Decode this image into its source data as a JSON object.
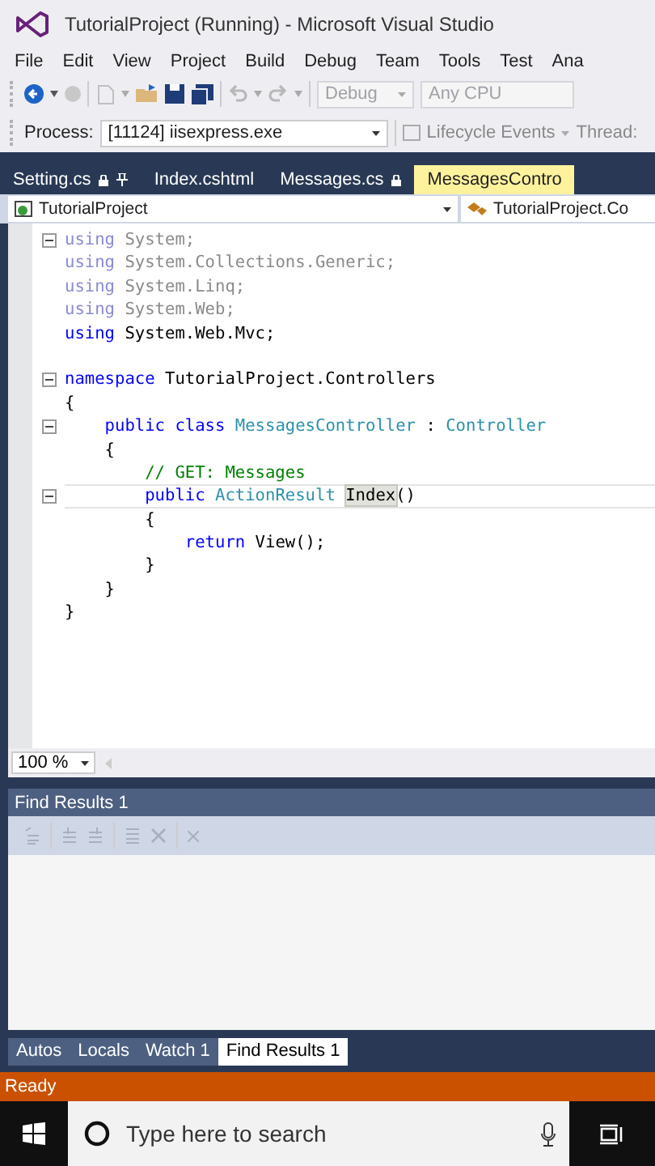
{
  "window": {
    "title": "TutorialProject (Running) - Microsoft Visual Studio"
  },
  "menu": [
    "File",
    "Edit",
    "View",
    "Project",
    "Build",
    "Debug",
    "Team",
    "Tools",
    "Test",
    "Ana"
  ],
  "toolbar": {
    "configuration": "Debug",
    "platform": "Any CPU"
  },
  "debug_location": {
    "process_label": "Process:",
    "process": "[11124] iisexpress.exe",
    "lifecycle": "Lifecycle Events",
    "thread_label": "Thread:"
  },
  "tabs": [
    {
      "label": "Setting.cs",
      "selected": false,
      "locked": true,
      "pinned": true
    },
    {
      "label": "Index.cshtml",
      "selected": false,
      "locked": false,
      "pinned": false
    },
    {
      "label": "Messages.cs",
      "selected": false,
      "locked": true,
      "pinned": false
    },
    {
      "label": "MessagesContro",
      "selected": true,
      "locked": false,
      "pinned": false
    }
  ],
  "navigation": {
    "project": "TutorialProject",
    "type": "TutorialProject.Co"
  },
  "code": {
    "lines": [
      {
        "fold": true,
        "current": false,
        "tokens": [
          {
            "text": "using",
            "kind": "keyword-faded"
          },
          {
            "text": " System;",
            "kind": "plain-faded"
          }
        ]
      },
      {
        "fold": false,
        "current": false,
        "tokens": [
          {
            "text": "using",
            "kind": "keyword-faded"
          },
          {
            "text": " System.Collections.Generic;",
            "kind": "plain-faded"
          }
        ]
      },
      {
        "fold": false,
        "current": false,
        "tokens": [
          {
            "text": "using",
            "kind": "keyword-faded"
          },
          {
            "text": " System.Linq;",
            "kind": "plain-faded"
          }
        ]
      },
      {
        "fold": false,
        "current": false,
        "tokens": [
          {
            "text": "using",
            "kind": "keyword-faded"
          },
          {
            "text": " System.Web;",
            "kind": "plain-faded"
          }
        ]
      },
      {
        "fold": false,
        "current": false,
        "tokens": [
          {
            "text": "using",
            "kind": "keyword"
          },
          {
            "text": " System.Web.Mvc;",
            "kind": "plain"
          }
        ]
      },
      {
        "fold": false
      },
      {
        "fold": true,
        "current": false,
        "tokens": [
          {
            "text": "namespace",
            "kind": "keyword"
          },
          {
            "text": " TutorialProject.Controllers",
            "kind": "plain"
          }
        ]
      },
      {
        "fold": false,
        "current": false,
        "tokens": [
          {
            "text": "{",
            "kind": "plain"
          }
        ]
      },
      {
        "fold": true,
        "current": false,
        "tokens": [
          {
            "text": "    public class",
            "kind": "keyword"
          },
          {
            "text": " MessagesController",
            "kind": "type"
          },
          {
            "text": " : ",
            "kind": "plain"
          },
          {
            "text": "Controller",
            "kind": "type"
          }
        ]
      },
      {
        "fold": false,
        "current": false,
        "tokens": [
          {
            "text": "    {",
            "kind": "plain"
          }
        ]
      },
      {
        "fold": false,
        "current": false,
        "tokens": [
          {
            "text": "        // GET: Messages",
            "kind": "comment"
          }
        ]
      },
      {
        "fold": true,
        "current": true,
        "tokens": [
          {
            "text": "        public",
            "kind": "keyword"
          },
          {
            "text": " ActionResult ",
            "kind": "type"
          },
          {
            "text": "Index",
            "kind": "highlight"
          },
          {
            "text": "()",
            "kind": "plain"
          }
        ]
      },
      {
        "fold": false,
        "current": false,
        "tokens": [
          {
            "text": "        {",
            "kind": "plain"
          }
        ]
      },
      {
        "fold": false,
        "current": false,
        "tokens": [
          {
            "text": "            return",
            "kind": "keyword"
          },
          {
            "text": " View();",
            "kind": "plain"
          }
        ]
      },
      {
        "fold": false,
        "current": false,
        "tokens": [
          {
            "text": "        }",
            "kind": "plain"
          }
        ]
      },
      {
        "fold": false,
        "current": false,
        "tokens": [
          {
            "text": "    }",
            "kind": "plain"
          }
        ]
      },
      {
        "fold": false,
        "current": false,
        "tokens": [
          {
            "text": "}",
            "kind": "plain"
          }
        ]
      }
    ]
  },
  "zoom": "100 %",
  "find_panel": {
    "title": "Find Results 1"
  },
  "bottom_tabs": [
    {
      "label": "Autos",
      "selected": false
    },
    {
      "label": "Locals",
      "selected": false
    },
    {
      "label": "Watch 1",
      "selected": false
    },
    {
      "label": "Find Results 1",
      "selected": true
    }
  ],
  "status_bar": "Ready",
  "taskbar": {
    "search_placeholder": "Type here to search"
  }
}
